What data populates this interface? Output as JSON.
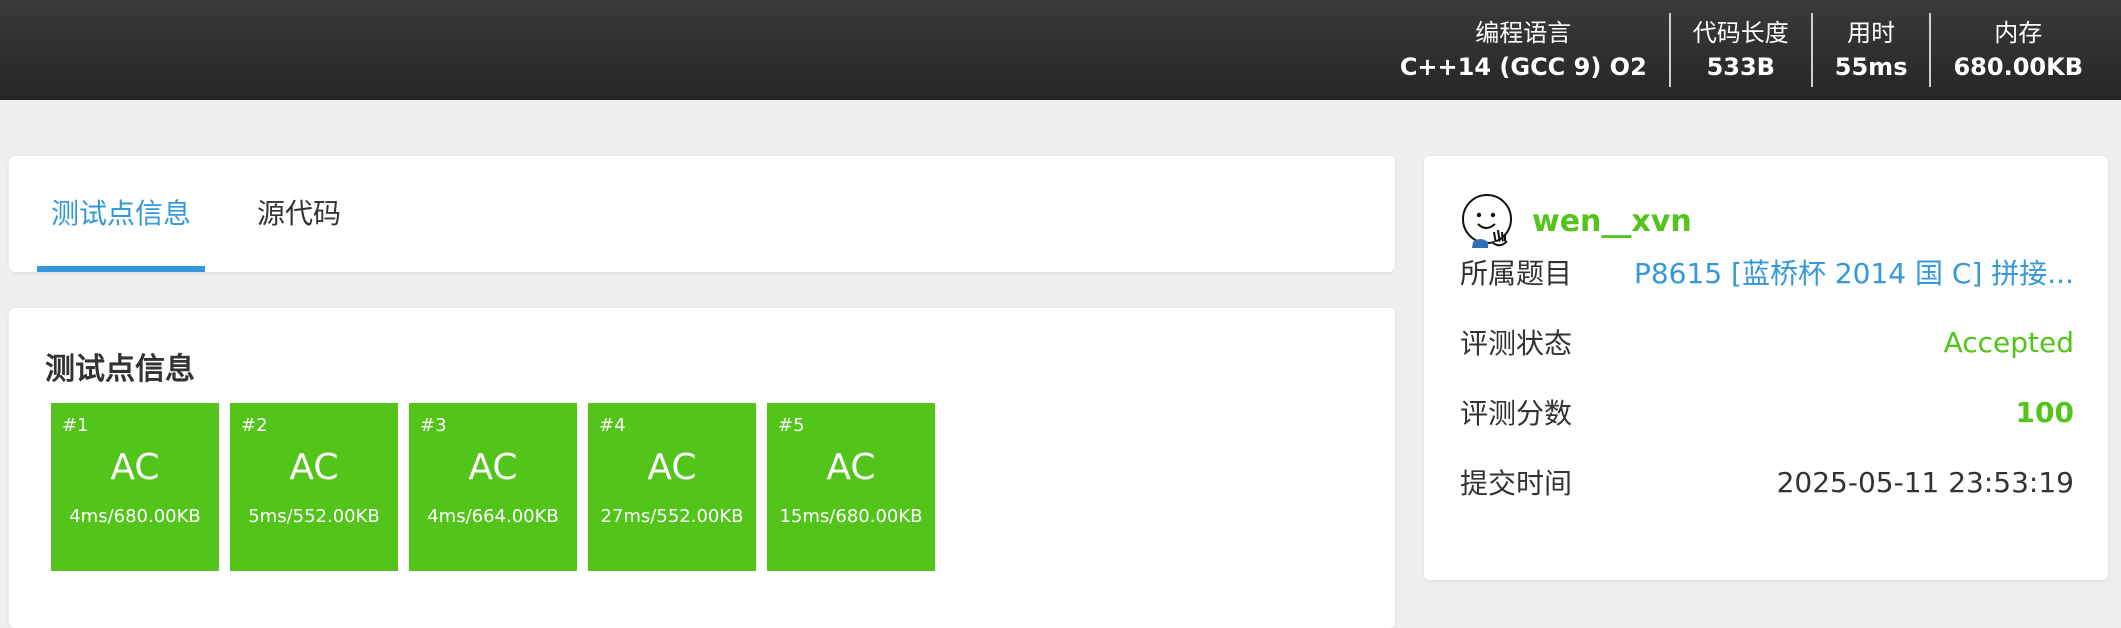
{
  "header": {
    "stats": [
      {
        "label": "编程语言",
        "value": "C++14 (GCC 9) O2"
      },
      {
        "label": "代码长度",
        "value": "533B"
      },
      {
        "label": "用时",
        "value": "55ms"
      },
      {
        "label": "内存",
        "value": "680.00KB"
      }
    ]
  },
  "tabs": [
    {
      "label": "测试点信息",
      "active": true
    },
    {
      "label": "源代码",
      "active": false
    }
  ],
  "cases": {
    "title": "测试点信息",
    "color": "#52c41a",
    "items": [
      {
        "id": "#1",
        "status": "AC",
        "meta": "4ms/680.00KB"
      },
      {
        "id": "#2",
        "status": "AC",
        "meta": "5ms/552.00KB"
      },
      {
        "id": "#3",
        "status": "AC",
        "meta": "4ms/664.00KB"
      },
      {
        "id": "#4",
        "status": "AC",
        "meta": "27ms/552.00KB"
      },
      {
        "id": "#5",
        "status": "AC",
        "meta": "15ms/680.00KB"
      }
    ]
  },
  "side": {
    "username": "wen__xvn",
    "rows": [
      {
        "label": "所属题目",
        "value": "P8615 [蓝桥杯 2014 国 C] 拼接..."
      },
      {
        "label": "评测状态",
        "value": "Accepted"
      },
      {
        "label": "评测分数",
        "value": "100"
      },
      {
        "label": "提交时间",
        "value": "2025-05-11 23:53:19"
      }
    ]
  },
  "colors": {
    "accent": "#3498db",
    "success": "#52c41a",
    "header_bg": "#2e2e2e"
  }
}
